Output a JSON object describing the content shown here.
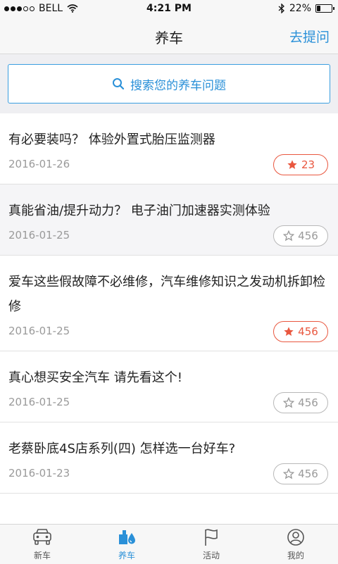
{
  "status": {
    "carrier": "BELL",
    "time": "4:21 PM",
    "battery": "22%",
    "battery_level": 0.22,
    "signal_filled": 3,
    "signal_total": 5
  },
  "nav": {
    "title": "养车",
    "action": "去提问"
  },
  "search": {
    "placeholder": "搜索您的养车问题",
    "icon": "search-icon"
  },
  "articles": [
    {
      "title": "有必要装吗？ 体验外置式胎压监测器",
      "date": "2016-01-26",
      "count": "23",
      "favorited": true
    },
    {
      "title": "真能省油/提升动力？ 电子油门加速器实测体验",
      "date": "2016-01-25",
      "count": "456",
      "favorited": false
    },
    {
      "title": "爱车这些假故障不必维修，汽车维修知识之发动机拆卸检修",
      "date": "2016-01-25",
      "count": "456",
      "favorited": true
    },
    {
      "title": "真心想买安全汽车 请先看这个!",
      "date": "2016-01-25",
      "count": "456",
      "favorited": false
    },
    {
      "title": "老蔡卧底4S店系列(四) 怎样选一台好车?",
      "date": "2016-01-23",
      "count": "456",
      "favorited": false
    }
  ],
  "tabs": [
    {
      "label": "新车",
      "icon": "car-icon",
      "active": false
    },
    {
      "label": "养车",
      "icon": "maintenance-icon",
      "active": true
    },
    {
      "label": "活动",
      "icon": "flag-icon",
      "active": false
    },
    {
      "label": "我的",
      "icon": "profile-icon",
      "active": false
    }
  ],
  "colors": {
    "accent": "#2a90d8",
    "favorite": "#e9573f",
    "muted": "#9a9a9a"
  }
}
